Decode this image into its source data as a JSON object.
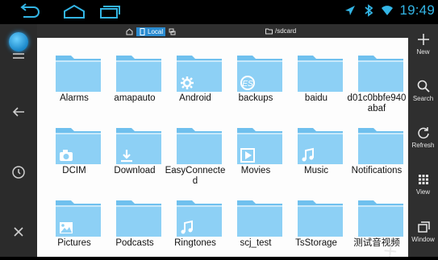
{
  "status_bar": {
    "time": "19:49",
    "icons": [
      "back-icon",
      "home-icon",
      "recent-apps-icon",
      "location-icon",
      "bluetooth-icon",
      "wifi-icon"
    ],
    "accent": "#33b5e5"
  },
  "path_bar": {
    "current": "Local",
    "path": "/sdcard"
  },
  "right_panel": {
    "new_label": "New",
    "search_label": "Search",
    "refresh_label": "Refresh",
    "view_label": "View",
    "window_label": "Window"
  },
  "folders": [
    {
      "name": "Alarms"
    },
    {
      "name": "amapauto"
    },
    {
      "name": "Android",
      "badge": "gear-icon"
    },
    {
      "name": "backups",
      "badge": "es-icon"
    },
    {
      "name": "baidu"
    },
    {
      "name": "d01c0bbfe940abaf"
    },
    {
      "name": "DCIM",
      "badge": "camera-icon"
    },
    {
      "name": "Download",
      "badge": "download-icon"
    },
    {
      "name": "EasyConnected"
    },
    {
      "name": "Movies",
      "badge": "play-icon"
    },
    {
      "name": "Music",
      "badge": "music-note-icon"
    },
    {
      "name": "Notifications"
    },
    {
      "name": "Pictures",
      "badge": "picture-icon"
    },
    {
      "name": "Podcasts"
    },
    {
      "name": "Ringtones",
      "badge": "music-note-icon"
    },
    {
      "name": "scj_test"
    },
    {
      "name": "TsStorage"
    },
    {
      "name": "测试音视频"
    }
  ],
  "colors": {
    "folder": "#8dd0f5",
    "folder_tab": "#6fc0ee",
    "highlight": "#2a8bd0"
  }
}
